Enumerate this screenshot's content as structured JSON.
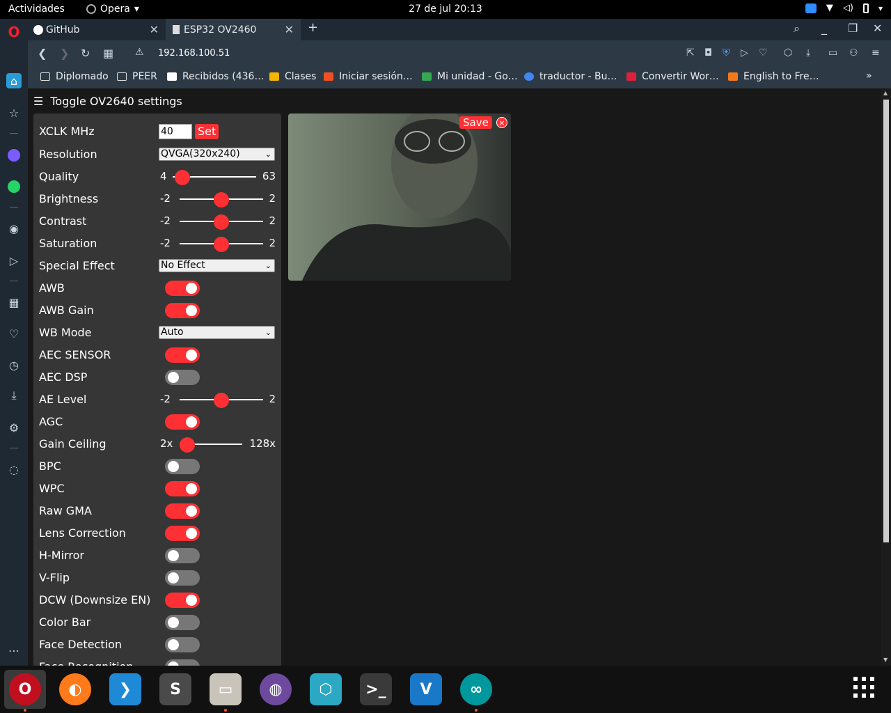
{
  "topbar": {
    "activities": "Actividades",
    "app_menu": "Opera",
    "clock": "27 de jul  20:13"
  },
  "tabs": [
    {
      "label": "GitHub",
      "icon": "github-icon"
    },
    {
      "label": "ESP32 OV2460",
      "icon": "document-icon"
    }
  ],
  "address": {
    "url": "192.168.100.51",
    "security": "warning-icon"
  },
  "bookmarks": [
    {
      "label": "Diplomado",
      "icon": "folder-icon"
    },
    {
      "label": "PEER",
      "icon": "folder-icon"
    },
    {
      "label": "Recibidos (436…",
      "icon": "document-icon"
    },
    {
      "label": "Clases",
      "icon": "classroom-icon"
    },
    {
      "label": "Iniciar sesión…",
      "icon": "microsoft-icon"
    },
    {
      "label": "Mi unidad - Go…",
      "icon": "drive-icon"
    },
    {
      "label": "traductor - Bu…",
      "icon": "google-icon"
    },
    {
      "label": "Convertir Wor…",
      "icon": "heart-icon"
    },
    {
      "label": "English to Fre…",
      "icon": "reverso-icon"
    }
  ],
  "page": {
    "toggle_label": "Toggle OV2640 settings",
    "xclk": {
      "label": "XCLK MHz",
      "value": "40",
      "button": "Set"
    },
    "controls": [
      {
        "label": "Resolution",
        "type": "select",
        "value": "QVGA(320x240)"
      },
      {
        "label": "Quality",
        "type": "range",
        "min": "4",
        "max": "63",
        "level": 0.12
      },
      {
        "label": "Brightness",
        "type": "range",
        "min": "-2",
        "max": "2",
        "level": 0.5
      },
      {
        "label": "Contrast",
        "type": "range",
        "min": "-2",
        "max": "2",
        "level": 0.5
      },
      {
        "label": "Saturation",
        "type": "range",
        "min": "-2",
        "max": "2",
        "level": 0.5
      },
      {
        "label": "Special Effect",
        "type": "select",
        "value": "No Effect"
      },
      {
        "label": "AWB",
        "type": "switch",
        "on": true
      },
      {
        "label": "AWB Gain",
        "type": "switch",
        "on": true
      },
      {
        "label": "WB Mode",
        "type": "select",
        "value": "Auto"
      },
      {
        "label": "AEC SENSOR",
        "type": "switch",
        "on": true
      },
      {
        "label": "AEC DSP",
        "type": "switch",
        "on": false
      },
      {
        "label": "AE Level",
        "type": "range",
        "min": "-2",
        "max": "2",
        "level": 0.5
      },
      {
        "label": "AGC",
        "type": "switch",
        "on": true
      },
      {
        "label": "Gain Ceiling",
        "type": "range",
        "min": "2x",
        "max": "128x",
        "level": 0.0
      },
      {
        "label": "BPC",
        "type": "switch",
        "on": false
      },
      {
        "label": "WPC",
        "type": "switch",
        "on": true
      },
      {
        "label": "Raw GMA",
        "type": "switch",
        "on": true
      },
      {
        "label": "Lens Correction",
        "type": "switch",
        "on": true
      },
      {
        "label": "H-Mirror",
        "type": "switch",
        "on": false
      },
      {
        "label": "V-Flip",
        "type": "switch",
        "on": false
      },
      {
        "label": "DCW (Downsize EN)",
        "type": "switch",
        "on": true
      },
      {
        "label": "Color Bar",
        "type": "switch",
        "on": false
      },
      {
        "label": "Face Detection",
        "type": "switch",
        "on": false
      },
      {
        "label": "Face Recognition",
        "type": "switch",
        "on": false
      }
    ],
    "stream": {
      "save_label": "Save",
      "close_label": "×"
    }
  },
  "colors": {
    "accent": "#ff3034",
    "panel": "#363636",
    "page_bg": "#181818",
    "chrome": "#2d3a46"
  },
  "dock": [
    {
      "name": "opera",
      "icon": "opera-icon",
      "color": "#c01020",
      "running": true
    },
    {
      "name": "firefox",
      "icon": "firefox-icon",
      "color": "#ff7a1a",
      "running": false
    },
    {
      "name": "vscode",
      "icon": "vscode-icon",
      "color": "#1e8ad6",
      "running": false
    },
    {
      "name": "sublime",
      "icon": "sublime-icon",
      "color": "#4a4a4a",
      "running": false
    },
    {
      "name": "files",
      "icon": "files-icon",
      "color": "#c9c4ba",
      "running": true
    },
    {
      "name": "github-desktop",
      "icon": "github-icon",
      "color": "#6e4a9e",
      "running": false
    },
    {
      "name": "virtualbox",
      "icon": "box-icon",
      "color": "#2aa8c4",
      "running": false
    },
    {
      "name": "terminal",
      "icon": "terminal-icon",
      "color": "#3a3a3a",
      "running": false
    },
    {
      "name": "vnc",
      "icon": "vnc-icon",
      "color": "#1a78c8",
      "running": false
    },
    {
      "name": "arduino",
      "icon": "arduino-icon",
      "color": "#00979d",
      "running": true
    }
  ]
}
